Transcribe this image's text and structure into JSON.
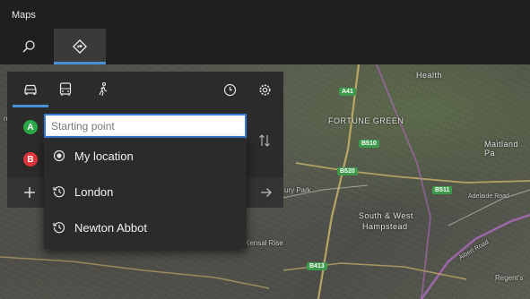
{
  "app": {
    "title": "Maps"
  },
  "toolbar": {
    "search_icon": "search-icon",
    "directions_icon": "directions-icon"
  },
  "directions": {
    "modes": [
      {
        "name": "drive",
        "icon": "car-icon",
        "selected": true
      },
      {
        "name": "transit",
        "icon": "bus-icon",
        "selected": false
      },
      {
        "name": "walk",
        "icon": "walk-icon",
        "selected": false
      }
    ],
    "start_badge": "A",
    "end_badge": "B",
    "start_placeholder": "Starting point"
  },
  "dropdown": {
    "items": [
      {
        "label": "My location",
        "icon": "location-icon"
      },
      {
        "label": "London",
        "icon": "history-icon"
      },
      {
        "label": "Newton Abbot",
        "icon": "history-icon"
      }
    ]
  },
  "map": {
    "road_labels": [
      "A41",
      "B510",
      "B520",
      "B511",
      "B413"
    ],
    "places": {
      "health": "Health",
      "fortune_green": "FORTUNE GREEN",
      "maitland": "Maitland Pa",
      "south_west_hampstead_1": "South & West",
      "south_west_hampstead_2": "Hampstead",
      "kensal_rise": "Kensal Rise",
      "ury_park": "ury Park",
      "adelaide_road": "Adelaide Road",
      "regents": "Regent's",
      "albert_road": "Albert Road",
      "ro": "ro",
      "s": "s"
    }
  },
  "colors": {
    "accent": "#4a90d9",
    "panel_bg": "#2b2b2b",
    "badge_a": "#27a745",
    "badge_b": "#e0363b",
    "road_sign": "#3c9a4a"
  }
}
